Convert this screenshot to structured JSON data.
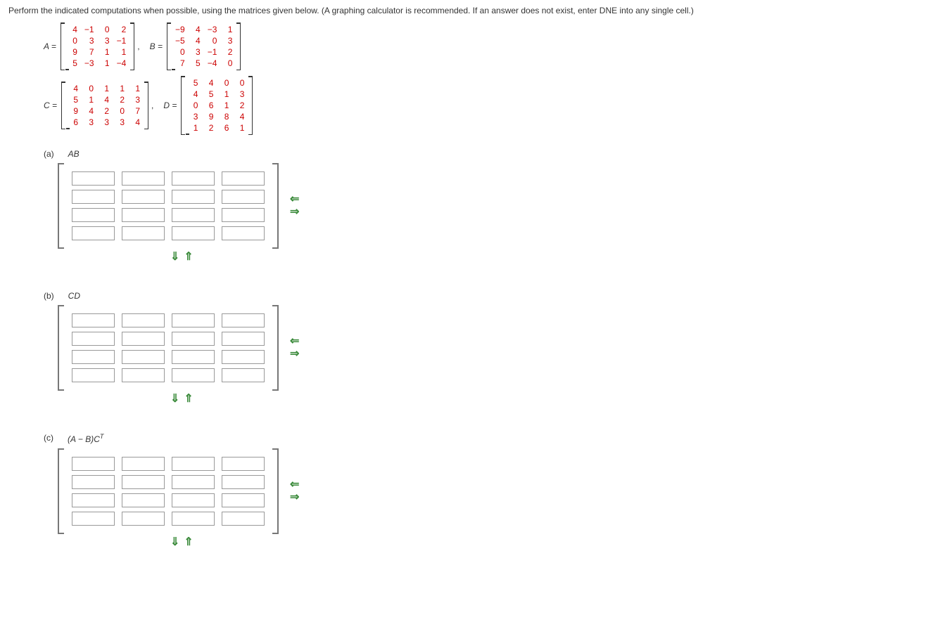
{
  "instruction": "Perform the indicated computations when possible, using the matrices given below. (A graphing calculator is recommended. If an answer does not exist, enter DNE into any single cell.)",
  "matrices": {
    "A": {
      "label": "A",
      "eq": "=",
      "rows": [
        [
          "4",
          "−1",
          "0",
          "2"
        ],
        [
          "0",
          "3",
          "3",
          "−1"
        ],
        [
          "9",
          "7",
          "1",
          "1"
        ],
        [
          "5",
          "−3",
          "1",
          "−4"
        ]
      ]
    },
    "B": {
      "label": "B",
      "eq": "=",
      "rows": [
        [
          "−9",
          "4",
          "−3",
          "1"
        ],
        [
          "−5",
          "4",
          "0",
          "3"
        ],
        [
          "0",
          "3",
          "−1",
          "2"
        ],
        [
          "7",
          "5",
          "−4",
          "0"
        ]
      ]
    },
    "C": {
      "label": "C",
      "eq": "=",
      "rows": [
        [
          "4",
          "0",
          "1",
          "1",
          "1"
        ],
        [
          "5",
          "1",
          "4",
          "2",
          "3"
        ],
        [
          "9",
          "4",
          "2",
          "0",
          "7"
        ],
        [
          "6",
          "3",
          "3",
          "3",
          "4"
        ]
      ]
    },
    "D": {
      "label": "D",
      "eq": "=",
      "rows": [
        [
          "5",
          "4",
          "0",
          "0"
        ],
        [
          "4",
          "5",
          "1",
          "3"
        ],
        [
          "0",
          "6",
          "1",
          "2"
        ],
        [
          "3",
          "9",
          "8",
          "4"
        ],
        [
          "1",
          "2",
          "6",
          "1"
        ]
      ]
    },
    "comma": ","
  },
  "parts": {
    "a": {
      "id": "(a)",
      "expr": "AB"
    },
    "b": {
      "id": "(b)",
      "expr": "CD"
    },
    "c": {
      "id": "(c)",
      "expr_pre": "(A − B)C",
      "expr_sup": "T"
    }
  },
  "arrows": {
    "left": "⇐",
    "right": "⇒",
    "down": "⇓",
    "up": "⇑"
  },
  "answer_grid": {
    "rows": 4,
    "cols": 4
  }
}
